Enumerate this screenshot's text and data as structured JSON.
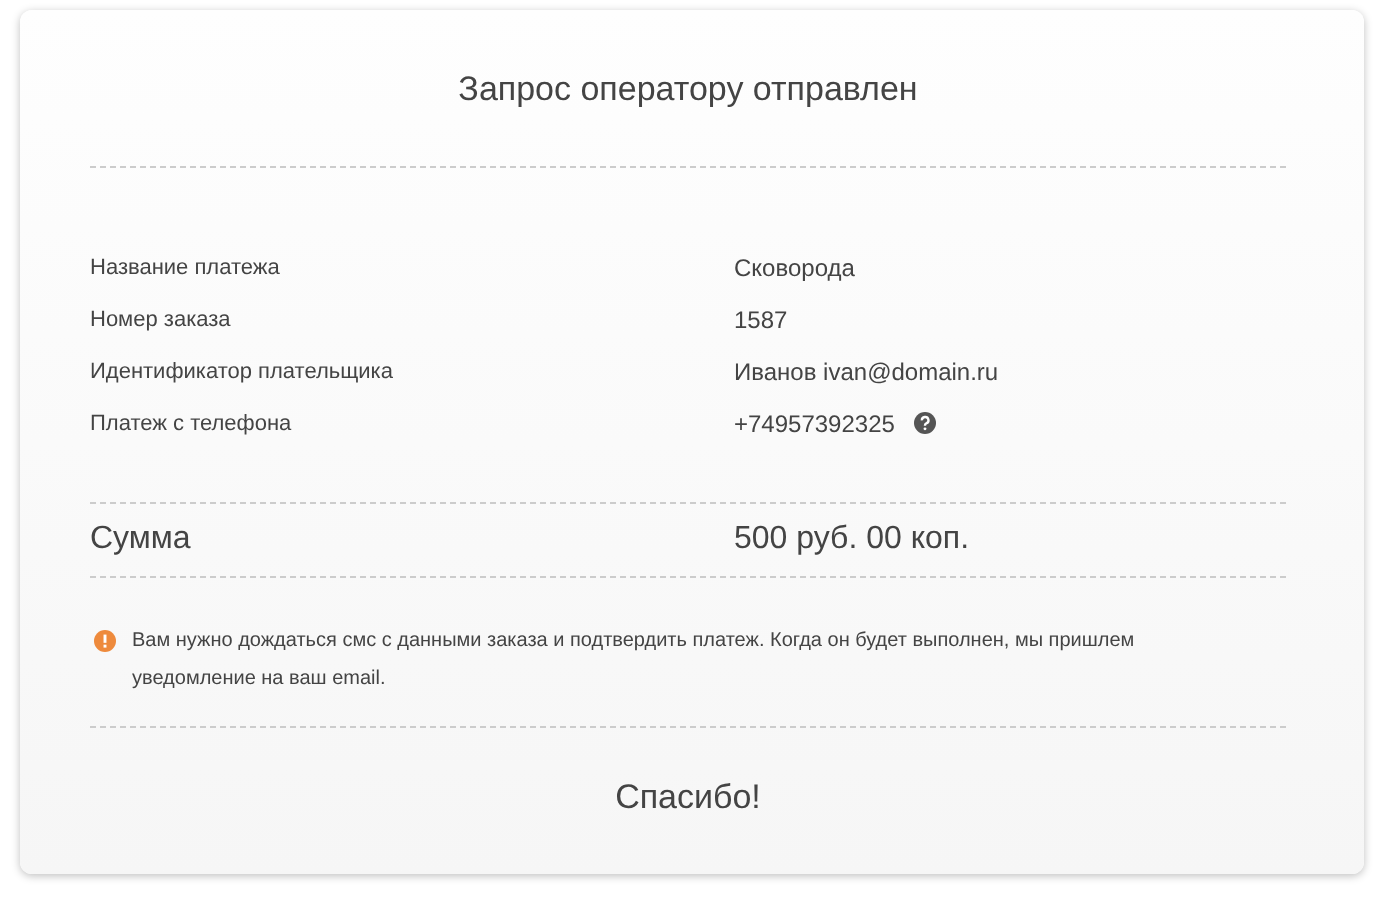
{
  "title": "Запрос оператору отправлен",
  "details": [
    {
      "label": "Название платежа",
      "value": "Сковорода",
      "help": false
    },
    {
      "label": "Номер заказа",
      "value": "1587",
      "help": false
    },
    {
      "label": "Идентификатор плательщика",
      "value": "Иванов ivan@domain.ru",
      "help": false
    },
    {
      "label": "Платеж с телефона",
      "value": "+74957392325",
      "help": true
    }
  ],
  "total": {
    "label": "Сумма",
    "value": "500 руб. 00 коп."
  },
  "notice": "Вам нужно дождаться смс с данными заказа и подтвердить платеж. Когда он будет выполнен, мы пришлем уведомление на ваш email.",
  "footer": "Спасибо!"
}
